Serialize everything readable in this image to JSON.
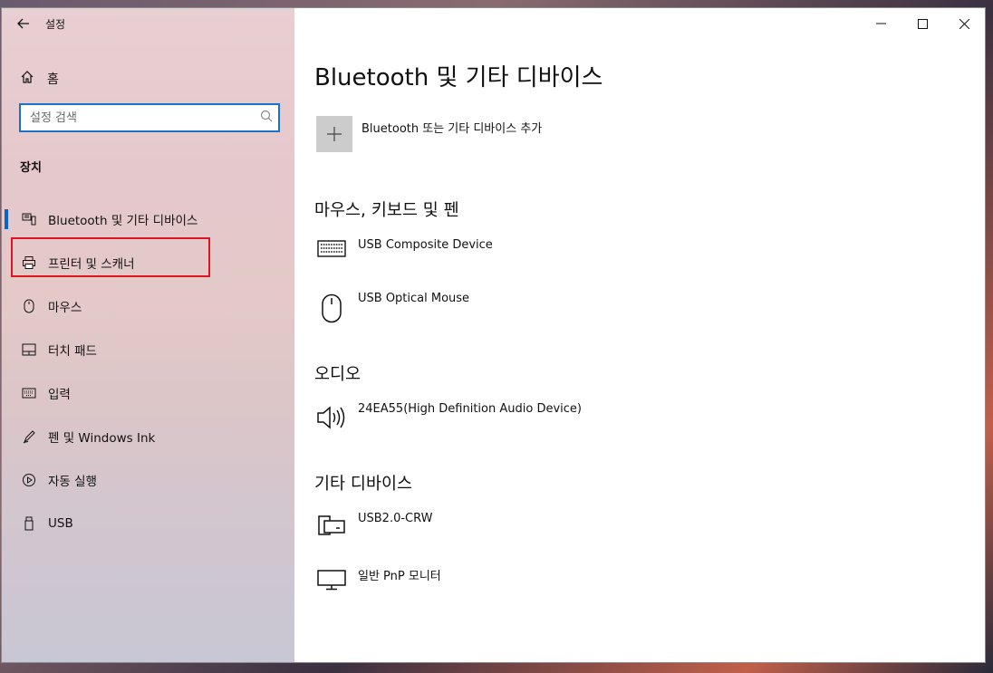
{
  "window": {
    "title": "설정",
    "back_icon": "back-arrow-icon"
  },
  "sidebar": {
    "home_label": "홈",
    "search_placeholder": "설정 검색",
    "section_label": "장치",
    "items": [
      {
        "label": "Bluetooth 및 기타 디바이스",
        "icon": "bluetooth-devices-icon",
        "active": true
      },
      {
        "label": "프린터 및 스캐너",
        "icon": "printer-icon",
        "active": false
      },
      {
        "label": "마우스",
        "icon": "mouse-icon",
        "active": false
      },
      {
        "label": "터치 패드",
        "icon": "touchpad-icon",
        "active": false
      },
      {
        "label": "입력",
        "icon": "keyboard-icon",
        "active": false
      },
      {
        "label": "펜 및 Windows Ink",
        "icon": "pen-icon",
        "active": false
      },
      {
        "label": "자동 실행",
        "icon": "autoplay-icon",
        "active": false
      },
      {
        "label": "USB",
        "icon": "usb-icon",
        "active": false
      }
    ]
  },
  "main": {
    "title": "Bluetooth 및 기타 디바이스",
    "add_device_label": "Bluetooth 또는 기타 디바이스 추가",
    "groups": [
      {
        "title": "마우스, 키보드 및 펜",
        "devices": [
          {
            "name": "USB Composite Device",
            "icon": "keyboard-icon"
          },
          {
            "name": "USB Optical Mouse",
            "icon": "mouse-icon"
          }
        ]
      },
      {
        "title": "오디오",
        "devices": [
          {
            "name": "24EA55(High Definition Audio Device)",
            "icon": "speaker-icon"
          }
        ]
      },
      {
        "title": "기타 디바이스",
        "devices": [
          {
            "name": "USB2.0-CRW",
            "icon": "device-icon"
          },
          {
            "name": "일반 PnP 모니터",
            "icon": "monitor-icon"
          }
        ]
      }
    ]
  },
  "colors": {
    "accent": "#0a64c8",
    "highlight": "#e0141e",
    "search_border": "#1a73c8"
  }
}
